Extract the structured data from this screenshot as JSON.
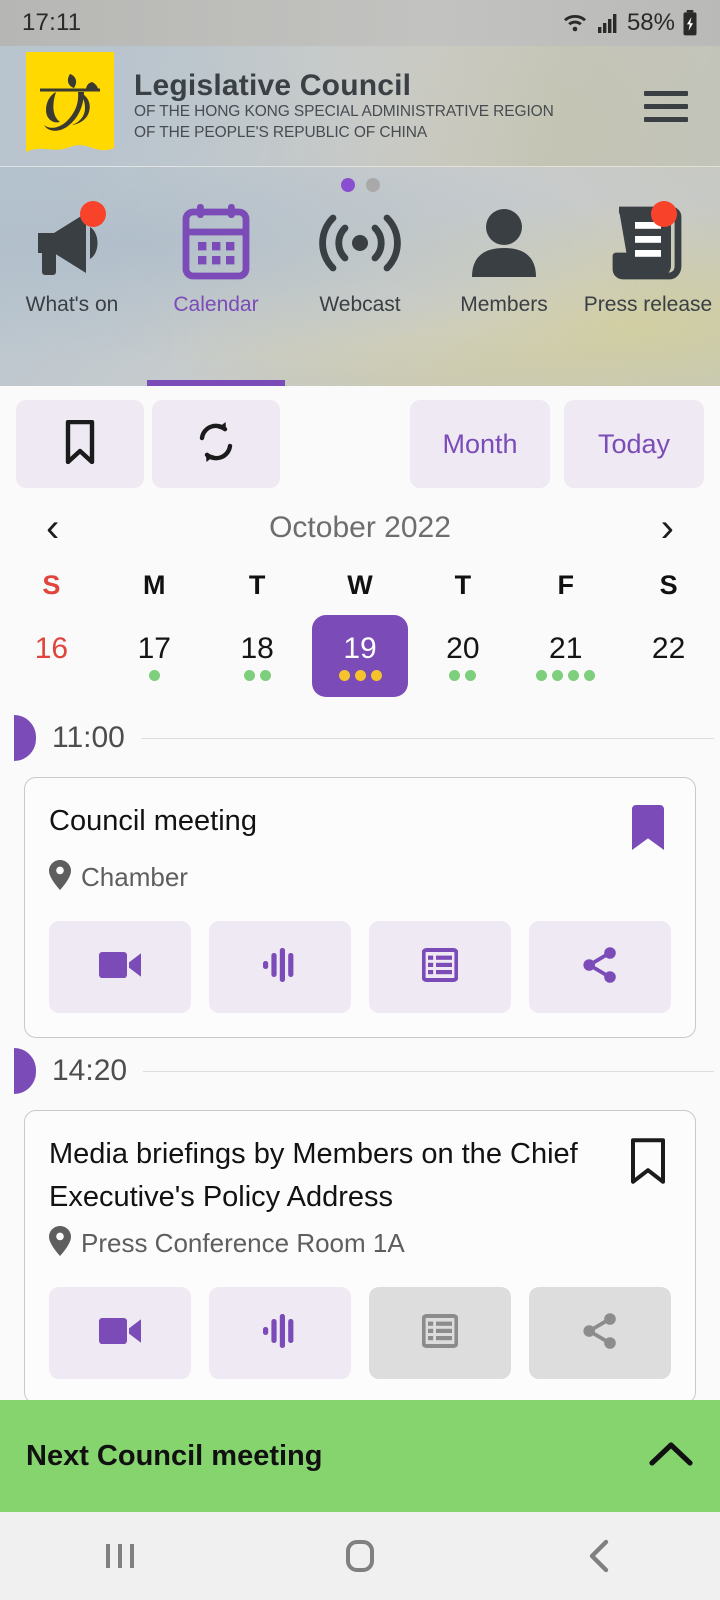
{
  "status_bar": {
    "time": "17:11",
    "battery_percent": "58%",
    "icons": [
      "wifi-icon",
      "cellular-signal-icon",
      "battery-charging-icon"
    ]
  },
  "header": {
    "title": "Legislative Council",
    "subtitle_line1": "OF THE HONG KONG SPECIAL ADMINISTRATIVE REGION",
    "subtitle_line2": "OF THE PEOPLE'S REPUBLIC OF CHINA",
    "logo_name": "legco-emblem-logo",
    "menu_icon": "hamburger-menu-icon"
  },
  "nav": {
    "page_dots": {
      "total": 2,
      "active_index": 0
    },
    "items": [
      {
        "label": "What's on",
        "icon": "megaphone-icon",
        "badge": true,
        "active": false
      },
      {
        "label": "Calendar",
        "icon": "calendar-icon",
        "badge": false,
        "active": true
      },
      {
        "label": "Webcast",
        "icon": "broadcast-icon",
        "badge": false,
        "active": false
      },
      {
        "label": "Members",
        "icon": "person-icon",
        "badge": false,
        "active": false
      },
      {
        "label": "Press release",
        "icon": "press-document-icon",
        "badge": true,
        "active": false
      }
    ]
  },
  "toolbar": {
    "bookmark_icon": "bookmark-icon",
    "refresh_icon": "sync-refresh-icon",
    "month_label": "Month",
    "today_label": "Today"
  },
  "calendar": {
    "prev_icon": "chevron-left-icon",
    "next_icon": "chevron-right-icon",
    "month_label": "October 2022",
    "day_headers": [
      "S",
      "M",
      "T",
      "W",
      "T",
      "F",
      "S"
    ],
    "days": [
      {
        "num": "16",
        "sunday": true,
        "selected": false,
        "dots": []
      },
      {
        "num": "17",
        "sunday": false,
        "selected": false,
        "dots": [
          "green"
        ]
      },
      {
        "num": "18",
        "sunday": false,
        "selected": false,
        "dots": [
          "green",
          "green"
        ]
      },
      {
        "num": "19",
        "sunday": false,
        "selected": true,
        "dots": [
          "yellow",
          "yellow",
          "yellow"
        ]
      },
      {
        "num": "20",
        "sunday": false,
        "selected": false,
        "dots": [
          "green",
          "green"
        ]
      },
      {
        "num": "21",
        "sunday": false,
        "selected": false,
        "dots": [
          "green",
          "green",
          "green",
          "green"
        ]
      },
      {
        "num": "22",
        "sunday": false,
        "selected": false,
        "dots": []
      }
    ]
  },
  "agenda": {
    "groups": [
      {
        "time": "11:00",
        "event": {
          "title": "Council meeting",
          "location": "Chamber",
          "location_icon": "map-pin-icon",
          "bookmarked": true,
          "actions": [
            {
              "icon": "video-camera-icon",
              "enabled": true
            },
            {
              "icon": "audio-waveform-icon",
              "enabled": true
            },
            {
              "icon": "agenda-list-icon",
              "enabled": true
            },
            {
              "icon": "share-icon",
              "enabled": true
            }
          ]
        }
      },
      {
        "time": "14:20",
        "event": {
          "title": "Media briefings by Members on the Chief Executive's Policy Address",
          "location": "Press Conference Room 1A",
          "location_icon": "map-pin-icon",
          "bookmarked": false,
          "actions": [
            {
              "icon": "video-camera-icon",
              "enabled": true
            },
            {
              "icon": "audio-waveform-icon",
              "enabled": true
            },
            {
              "icon": "agenda-list-icon",
              "enabled": false
            },
            {
              "icon": "share-icon",
              "enabled": false
            }
          ]
        }
      }
    ]
  },
  "bottom_bar": {
    "label": "Next Council meeting",
    "expand_icon": "chevron-up-icon"
  },
  "android_nav": {
    "recents_icon": "recents-icon",
    "home_icon": "home-icon",
    "back_icon": "back-icon"
  },
  "colors": {
    "accent_purple": "#7B4BB8",
    "badge_red": "#f9422a",
    "green_bar": "#86d46e",
    "sunday_red": "#e0443c",
    "dot_green": "#7dce7d",
    "dot_yellow": "#f5c32c",
    "logo_yellow": "#ffd900"
  }
}
